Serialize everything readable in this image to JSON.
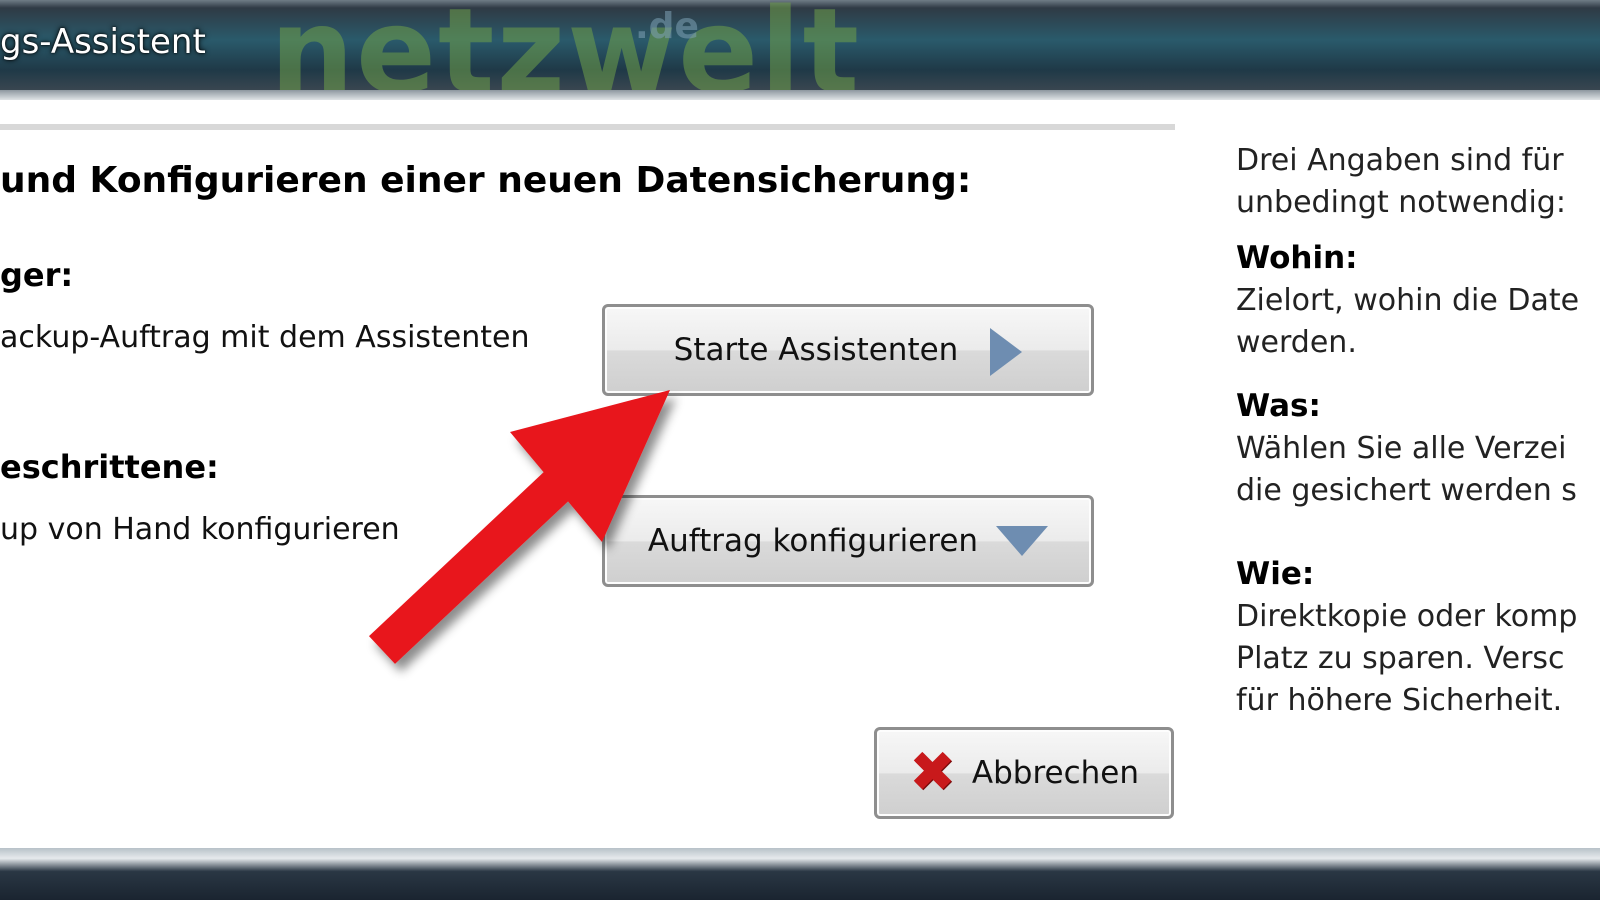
{
  "window": {
    "title": "gs-Assistent",
    "watermark": "netzwelt",
    "watermark_tld": ".de"
  },
  "main": {
    "heading": "und Konfigurieren einer neuen Datensicherung:",
    "sections": [
      {
        "label": "ger:",
        "description": "ackup-Auftrag mit dem Assistenten",
        "button": "Starte Assistenten",
        "button_icon": "play-arrow-icon"
      },
      {
        "label": "eschrittene:",
        "description": "up von Hand konfigurieren",
        "button": "Auftrag konfigurieren",
        "button_icon": "chevron-down-icon"
      }
    ],
    "cancel_button": "Abbrechen",
    "cancel_icon": "close-x-icon"
  },
  "sidebar": {
    "intro_line1": "Drei Angaben sind für",
    "intro_line2": "unbedingt notwendig:",
    "items": [
      {
        "heading": "Wohin:",
        "line1": "Zielort, wohin die Date",
        "line2": "werden."
      },
      {
        "heading": "Was:",
        "line1": "Wählen Sie alle Verzei",
        "line2": "die gesichert werden s"
      },
      {
        "heading": "Wie:",
        "line1": "Direktkopie oder komp",
        "line2": "Platz zu sparen. Versc",
        "line3": "für höhere Sicherheit."
      }
    ]
  },
  "annotation": {
    "arrow_color": "#e8141c"
  },
  "colors": {
    "accent_icon": "#6e8db1",
    "cancel_icon": "#c8191b"
  }
}
